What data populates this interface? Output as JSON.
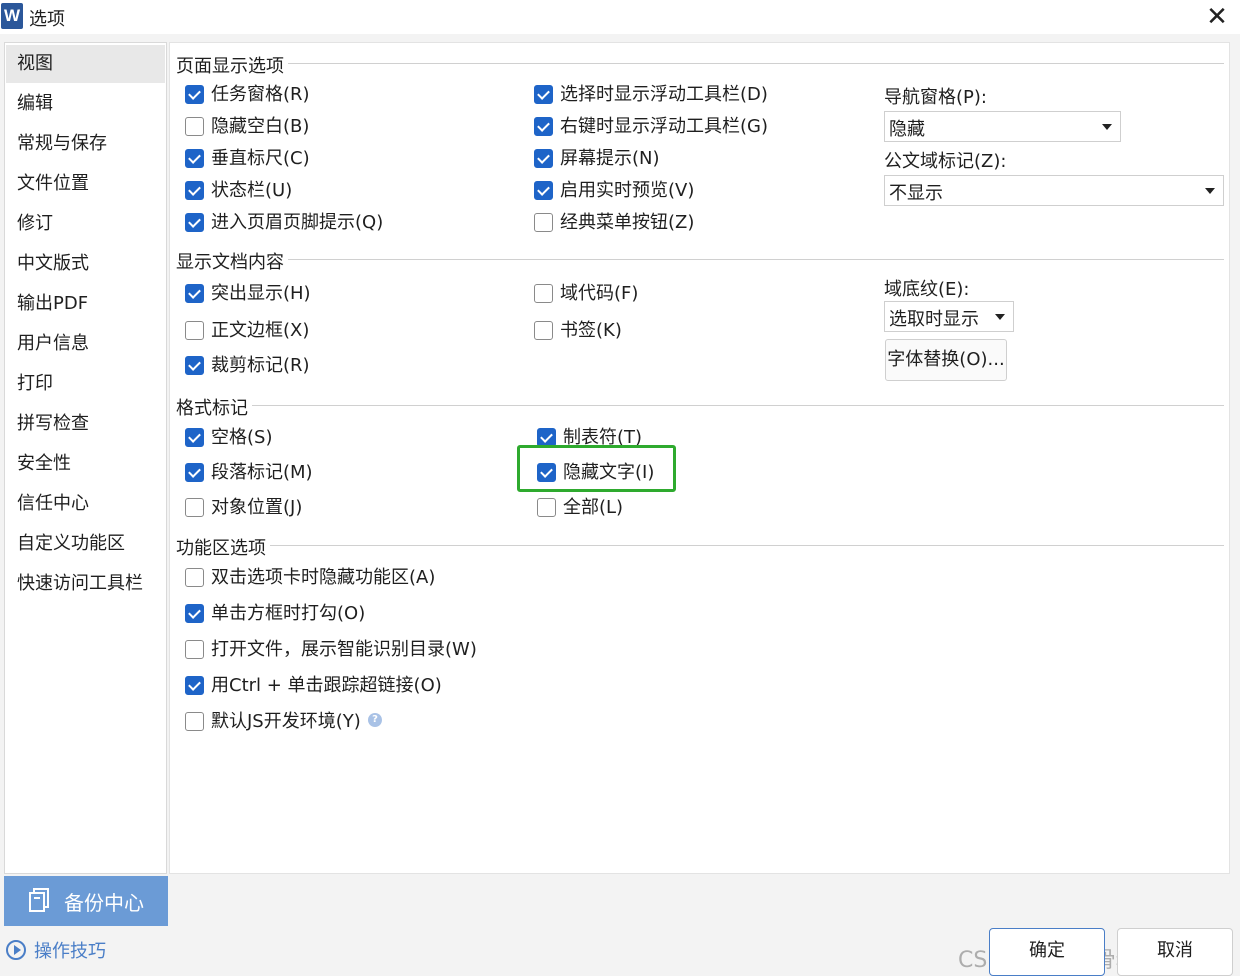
{
  "window": {
    "title": "选项",
    "logo_letter": "W",
    "close_glyph": "✕"
  },
  "sidebar": {
    "items": [
      {
        "label": "视图",
        "active": true
      },
      {
        "label": "编辑"
      },
      {
        "label": "常规与保存"
      },
      {
        "label": "文件位置"
      },
      {
        "label": "修订"
      },
      {
        "label": "中文版式"
      },
      {
        "label": "输出PDF"
      },
      {
        "label": "用户信息"
      },
      {
        "label": "打印"
      },
      {
        "label": "拼写检查"
      },
      {
        "label": "安全性"
      },
      {
        "label": "信任中心"
      },
      {
        "label": "自定义功能区"
      },
      {
        "label": "快速访问工具栏"
      }
    ],
    "backup_label": "备份中心",
    "tips_label": "操作技巧"
  },
  "page_display": {
    "title": "页面显示选项",
    "options": [
      {
        "label": "任务窗格(R)",
        "checked": true
      },
      {
        "label": "隐藏空白(B)",
        "checked": false
      },
      {
        "label": "垂直标尺(C)",
        "checked": true
      },
      {
        "label": "状态栏(U)",
        "checked": true
      },
      {
        "label": "进入页眉页脚提示(Q)",
        "checked": true
      },
      {
        "label": "选择时显示浮动工具栏(D)",
        "checked": true
      },
      {
        "label": "右键时显示浮动工具栏(G)",
        "checked": true
      },
      {
        "label": "屏幕提示(N)",
        "checked": true
      },
      {
        "label": "启用实时预览(V)",
        "checked": true
      },
      {
        "label": "经典菜单按钮(Z)",
        "checked": false
      }
    ],
    "nav_pane_label": "导航窗格(P):",
    "nav_pane_value": "隐藏",
    "doc_field_label": "公文域标记(Z):",
    "doc_field_value": "不显示"
  },
  "doc_content": {
    "title": "显示文档内容",
    "options": [
      {
        "label": "突出显示(H)",
        "checked": true
      },
      {
        "label": "正文边框(X)",
        "checked": false
      },
      {
        "label": "裁剪标记(R)",
        "checked": true
      },
      {
        "label": "域代码(F)",
        "checked": false
      },
      {
        "label": "书签(K)",
        "checked": false
      }
    ],
    "field_shading_label": "域底纹(E):",
    "field_shading_value": "选取时显示",
    "font_substitution_label": "字体替换(O)..."
  },
  "format_marks": {
    "title": "格式标记",
    "options": [
      {
        "label": "空格(S)",
        "checked": true
      },
      {
        "label": "段落标记(M)",
        "checked": true
      },
      {
        "label": "对象位置(J)",
        "checked": false
      },
      {
        "label": "制表符(T)",
        "checked": true
      },
      {
        "label": "隐藏文字(I)",
        "checked": true
      },
      {
        "label": "全部(L)",
        "checked": false
      }
    ]
  },
  "ribbon": {
    "title": "功能区选项",
    "options": [
      {
        "label": "双击选项卡时隐藏功能区(A)",
        "checked": false
      },
      {
        "label": "单击方框时打勾(O)",
        "checked": true
      },
      {
        "label": "打开文件，展示智能识别目录(W)",
        "checked": false
      },
      {
        "label": "用Ctrl + 单击跟踪超链接(O)",
        "checked": true
      },
      {
        "label": "默认JS开发环境(Y)",
        "checked": false
      }
    ]
  },
  "footer": {
    "ok_label": "确定",
    "cancel_label": "取消",
    "watermark": "CSDN @头盖骨粉碎性骨折"
  },
  "colors": {
    "accent": "#1e64c8",
    "highlight": "#2eaa2e",
    "backup_bg": "#6b9bd6"
  }
}
